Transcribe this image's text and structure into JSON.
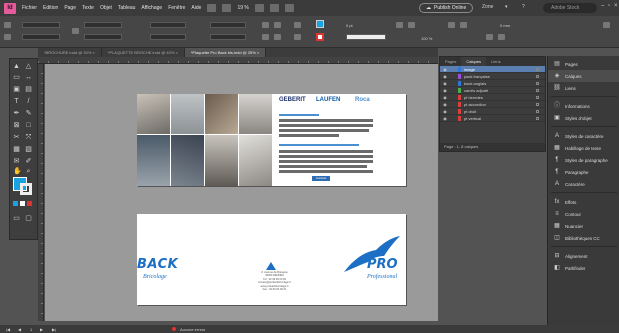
{
  "app": {
    "logo": "Id"
  },
  "menu": [
    "Fichier",
    "Edition",
    "Page",
    "Texte",
    "Objet",
    "Tableau",
    "Affichage",
    "Fenêtre",
    "Aide"
  ],
  "zoom": "19 %",
  "publish_online": "Publish Online",
  "workspace": "Zone",
  "search_placeholder": "Adobe Stock",
  "controlbar": {
    "stroke_weight": "0 pt",
    "opacity": "100 %",
    "value_field": "0 mm"
  },
  "doc_tabs": [
    "*BROCHURE.indd @ 30% ×",
    "*PLAQUETTE BROCHE.indd @ 40% ×",
    "*Plaquette Pro Back bis.indd @ 25% ×"
  ],
  "layers_panel": {
    "tabs": [
      "Pages",
      "Calques",
      "Liens"
    ],
    "active_tab": "Calques",
    "layers": [
      {
        "name": "image",
        "color": "#2f76d8",
        "selected": true
      },
      {
        "name": "pack française",
        "color": "#9b4dd6",
        "selected": false
      },
      {
        "name": "back anglais",
        "color": "#2f76d8",
        "selected": false
      },
      {
        "name": "carrés adjudé",
        "color": "#48b04b",
        "selected": false
      },
      {
        "name": "pt heredes",
        "color": "#d84040",
        "selected": false
      },
      {
        "name": "pt accordion",
        "color": "#d84040",
        "selected": false
      },
      {
        "name": "pt droit",
        "color": "#d84040",
        "selected": false
      },
      {
        "name": "pt vertical",
        "color": "#d84040",
        "selected": false
      }
    ],
    "footer": "Page : 1, 8 calques"
  },
  "dock": [
    {
      "icon": "pages-icon",
      "label": "Pages",
      "active": false
    },
    {
      "icon": "layers-icon",
      "label": "Calques",
      "active": true
    },
    {
      "icon": "links-icon",
      "label": "Liens",
      "active": false
    },
    {
      "icon": "info-icon",
      "label": "Informations",
      "active": false
    },
    {
      "icon": "object-styles-icon",
      "label": "Styles d'objet",
      "active": false
    },
    {
      "icon": "char-styles-icon",
      "label": "Styles de caractère",
      "active": false
    },
    {
      "icon": "text-wrap-icon",
      "label": "Habillage de texte",
      "active": false
    },
    {
      "icon": "para-styles-icon",
      "label": "Styles de paragraphe",
      "active": false
    },
    {
      "icon": "paragraph-icon",
      "label": "Paragraphe",
      "active": false
    },
    {
      "icon": "character-icon",
      "label": "Caractère",
      "active": false
    },
    {
      "icon": "effects-icon",
      "label": "Effets",
      "active": false
    },
    {
      "icon": "stroke-icon",
      "label": "Contour",
      "active": false
    },
    {
      "icon": "swatches-icon",
      "label": "Nuancier",
      "active": false
    },
    {
      "icon": "cc-libraries-icon",
      "label": "Bibliothèques CC",
      "active": false
    },
    {
      "icon": "align-icon",
      "label": "Alignement",
      "active": false
    },
    {
      "icon": "pathfinder-icon",
      "label": "Pathfinder",
      "active": false
    }
  ],
  "page1": {
    "logos": [
      "GEBERIT",
      "LAUFEN",
      "Roca"
    ],
    "button": "Contact"
  },
  "page2": {
    "logo_left": "BACK",
    "logo_left_sub": "Bricolage",
    "logo_right": "PRO",
    "logo_right_sub": "Professional",
    "address_lines": [
      "Z. Avenue de Bretagne",
      "35000 RENNES",
      "Tél : 02 99 00 00 00",
      "contact@probackbricolage.fr",
      "www.probackbricolage.fr",
      "Fax : 02 99 00 00 01"
    ]
  },
  "status": {
    "page": "1",
    "preflight": "Aucune erreur"
  },
  "colors": {
    "accent": "#1aa3e0",
    "brand_blue": "#1c6fc4",
    "selection": "#5a7fb0"
  }
}
